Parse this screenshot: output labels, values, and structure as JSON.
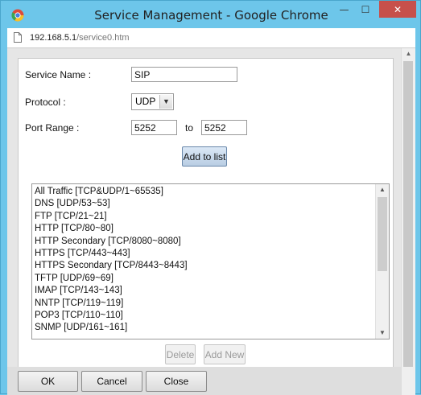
{
  "window": {
    "title": "Service Management - Google Chrome",
    "min_symbol": "—",
    "max_symbol": "☐",
    "close_symbol": "✕"
  },
  "address": {
    "host": "192.168.5.1",
    "path": "/service0.htm"
  },
  "form": {
    "service_name_label": "Service Name :",
    "service_name_value": "SIP",
    "protocol_label": "Protocol :",
    "protocol_value": "UDP",
    "port_range_label": "Port Range :",
    "port_from": "5252",
    "to_label": "to",
    "port_to": "5252",
    "add_button": "Add to list"
  },
  "services": [
    "All Traffic [TCP&UDP/1~65535]",
    "DNS [UDP/53~53]",
    "FTP [TCP/21~21]",
    "HTTP [TCP/80~80]",
    "HTTP Secondary [TCP/8080~8080]",
    "HTTPS [TCP/443~443]",
    "HTTPS Secondary [TCP/8443~8443]",
    "TFTP [UDP/69~69]",
    "IMAP [TCP/143~143]",
    "NNTP [TCP/119~119]",
    "POP3 [TCP/110~110]",
    "SNMP [UDP/161~161]"
  ],
  "list_buttons": {
    "delete": "Delete",
    "add_new": "Add New"
  },
  "footer": {
    "ok": "OK",
    "cancel": "Cancel",
    "close": "Close"
  },
  "icons": {
    "browser": "chrome-logo-icon",
    "page": "page-icon"
  }
}
